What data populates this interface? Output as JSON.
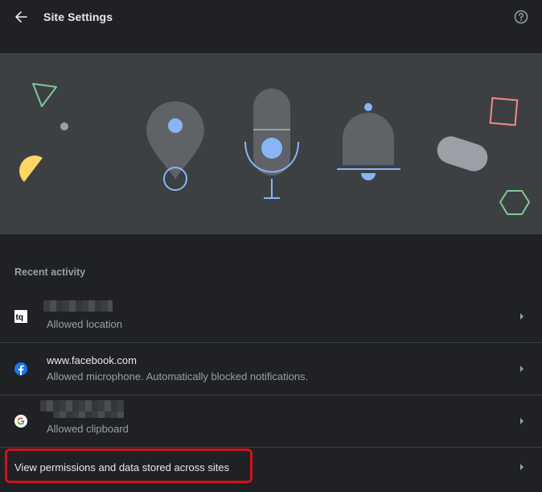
{
  "header": {
    "title": "Site Settings",
    "back_icon": "arrow-back-icon",
    "help_icon": "help-icon"
  },
  "banner": {
    "illustration": [
      "location-pin-icon",
      "microphone-icon",
      "notification-bell-icon"
    ],
    "colors": {
      "background": "#3c4043",
      "accent_blue": "#8ab4f8",
      "shape_gray": "#5f6368"
    }
  },
  "recent_activity": {
    "title": "Recent activity",
    "items": [
      {
        "site": "",
        "description": "Allowed location",
        "favicon": "tq-favicon",
        "site_obscured": true
      },
      {
        "site": "www.facebook.com",
        "description": "Allowed microphone. Automatically blocked notifications.",
        "favicon": "facebook-favicon",
        "site_obscured": false
      },
      {
        "site": "",
        "description": "Allowed clipboard",
        "favicon": "google-favicon",
        "site_obscured": true
      }
    ]
  },
  "view_all": {
    "label": "View permissions and data stored across sites"
  },
  "colors": {
    "background": "#202124",
    "divider": "#3c4043",
    "text_primary": "#e8eaed",
    "text_secondary": "#9aa0a6",
    "highlight": "#d0121b"
  }
}
